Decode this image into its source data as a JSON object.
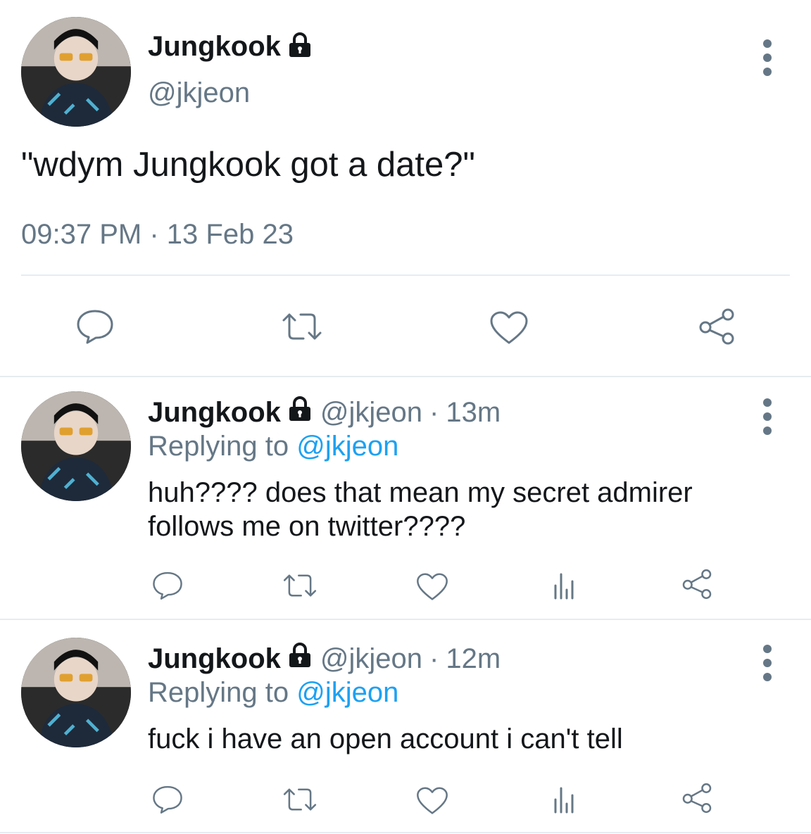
{
  "main_tweet": {
    "display_name": "Jungkook",
    "handle": "@jkjeon",
    "text": "\"wdym Jungkook got a date?\"",
    "time": "09:37 PM",
    "separator": "·",
    "date": "13 Feb 23"
  },
  "replies": [
    {
      "display_name": "Jungkook",
      "handle": "@jkjeon",
      "separator": "·",
      "age": "13m",
      "replying_prefix": "Replying to",
      "replying_handle": "@jkjeon",
      "text_line1": "huh???? does that mean my secret admirer",
      "text_line2": "follows me on twitter????"
    },
    {
      "display_name": "Jungkook",
      "handle": "@jkjeon",
      "separator": "·",
      "age": "12m",
      "replying_prefix": "Replying to",
      "replying_handle": "@jkjeon",
      "text_line1": "fuck i have an open account i can't tell"
    }
  ],
  "icons": {
    "lock": "lock-icon",
    "more": "more-vertical-icon",
    "reply": "reply-icon",
    "retweet": "retweet-icon",
    "like": "heart-icon",
    "share": "share-icon",
    "analytics": "analytics-icon"
  },
  "colors": {
    "text": "#14171a",
    "muted": "#657786",
    "link": "#1da1f2",
    "divider": "#e6ecf0"
  }
}
